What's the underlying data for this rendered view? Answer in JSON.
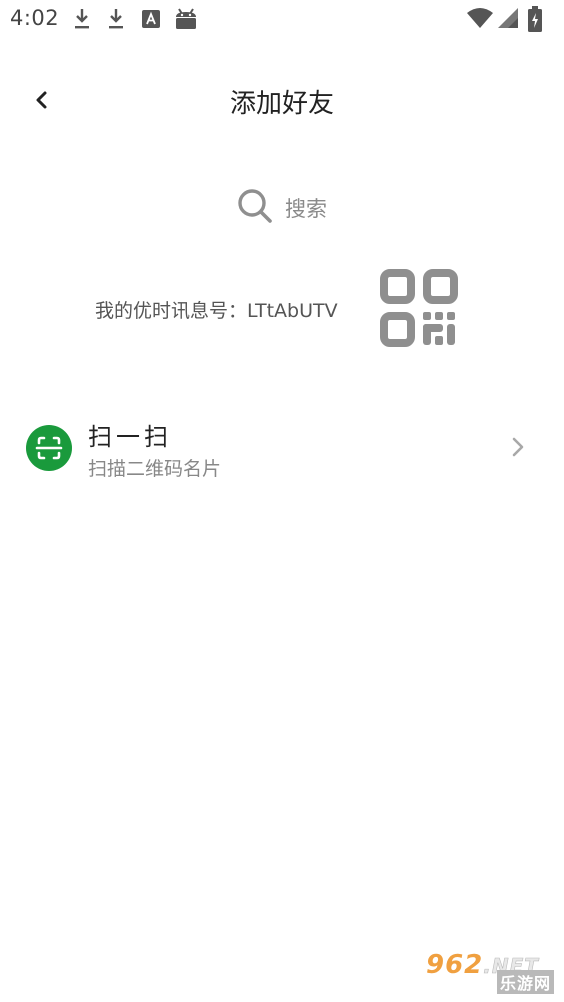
{
  "status_bar": {
    "time": "4:02",
    "left_icons": [
      "download-icon",
      "download-icon",
      "font-a-icon",
      "android-icon"
    ],
    "right_icons": [
      "wifi-icon",
      "signal-icon",
      "battery-charging-icon"
    ]
  },
  "header": {
    "title": "添加好友",
    "back_icon": "chevron-left-icon"
  },
  "search": {
    "label": "搜索",
    "icon": "search-icon"
  },
  "my_id": {
    "text": "我的优时讯息号：LTtAbUTV",
    "qr_icon": "qr-code-icon"
  },
  "scan": {
    "title": "扫一扫",
    "subtitle": "扫描二维码名片",
    "icon": "scan-icon",
    "icon_color": "#1a9a3c",
    "chevron_icon": "chevron-right-icon"
  },
  "watermark": {
    "main": "962",
    "net": ".NET",
    "sub": "乐游网"
  },
  "colors": {
    "background": "#ffffff",
    "title_text": "#222222",
    "secondary_text": "#888888",
    "accent_green": "#1a9a3c",
    "icon_gray": "#8f8f8f"
  }
}
